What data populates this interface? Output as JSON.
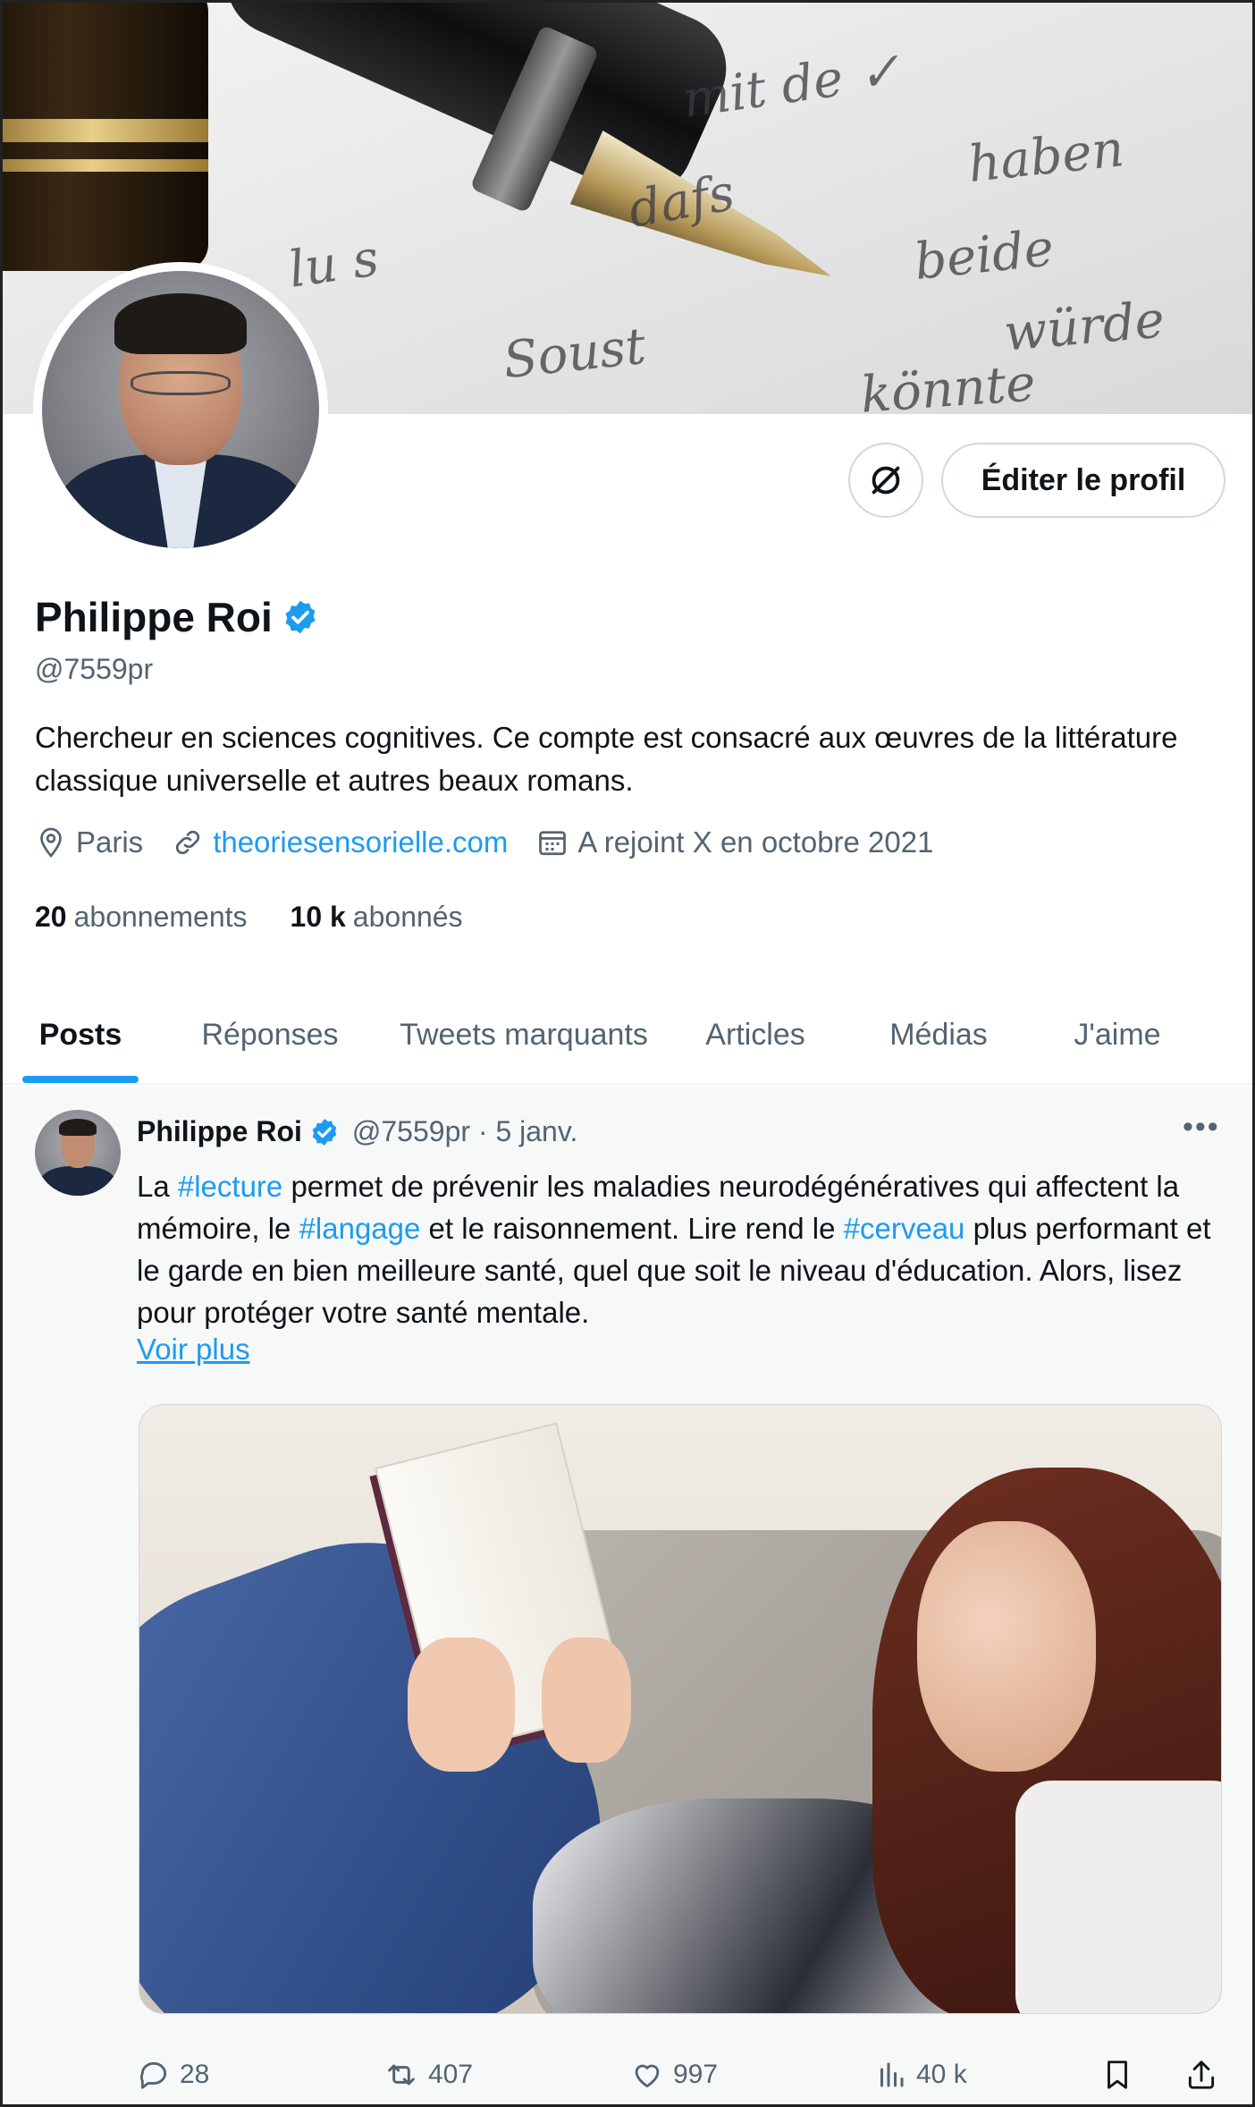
{
  "profile": {
    "name": "Philippe Roi",
    "handle": "@7559pr",
    "bio": "Chercheur en sciences cognitives. Ce compte est consacré aux œuvres de la littérature classique universelle et autres beaux romans.",
    "location": "Paris",
    "website": "theoriesensorielle.com",
    "joined": "A rejoint X en octobre 2021",
    "following_count": "20",
    "following_label": "abonnements",
    "followers_count": "10 k",
    "followers_label": "abonnés",
    "edit_button": "Éditer le profil"
  },
  "tabs": [
    {
      "label": "Posts",
      "active": true
    },
    {
      "label": "Réponses",
      "active": false
    },
    {
      "label": "Tweets marquants",
      "active": false
    },
    {
      "label": "Articles",
      "active": false
    },
    {
      "label": "Médias",
      "active": false
    },
    {
      "label": "J'aime",
      "active": false
    }
  ],
  "post": {
    "author": "Philippe Roi",
    "meta": "@7559pr · 5 janv.",
    "text": {
      "p1": "La ",
      "tag1": "#lecture",
      "p2": " permet de prévenir les maladies neurodégénératives qui affectent la mémoire, le ",
      "tag2": "#langage",
      "p3": " et le raisonnement. Lire rend le ",
      "tag3": "#cerveau",
      "p4": " plus performant et le garde en bien meilleure santé, quel que soit le niveau d'éducation. Alors, lisez pour protéger votre santé mentale."
    },
    "more_label": "Voir plus",
    "replies": "28",
    "reposts": "407",
    "likes": "997",
    "views": "40 k"
  },
  "colors": {
    "accent": "#1d9bf0",
    "text": "#0f1419",
    "muted": "#536471",
    "border": "#cfd9de"
  }
}
